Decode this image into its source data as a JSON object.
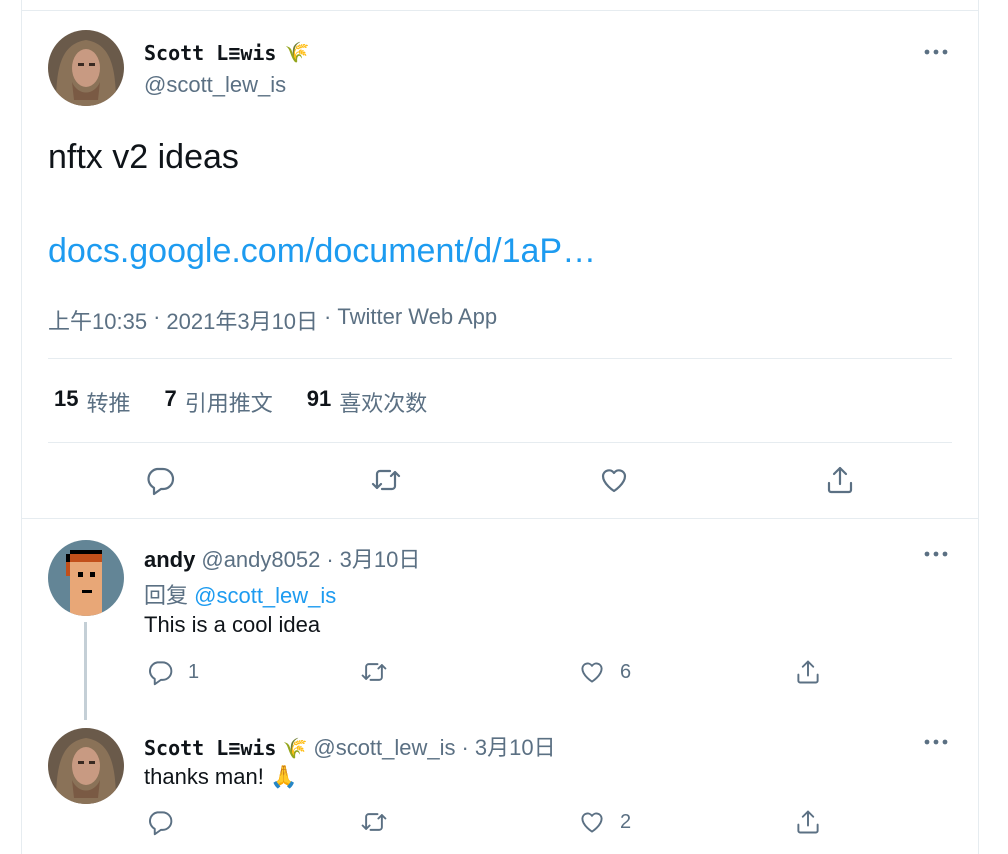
{
  "main_tweet": {
    "author_name": "Scott L≡wis",
    "author_emoji": "🌾",
    "author_handle": "@scott_lew_is",
    "text": "nftx v2 ideas",
    "link_text": "docs.google.com/document/d/1aP…",
    "time": "上午10:35",
    "separator1": "·",
    "date": "2021年3月10日",
    "separator2": "·",
    "app": "Twitter Web App",
    "stats": [
      {
        "num": "15",
        "label": "转推"
      },
      {
        "num": "7",
        "label": "引用推文"
      },
      {
        "num": "91",
        "label": "喜欢次数"
      }
    ]
  },
  "replies": [
    {
      "name": "andy",
      "handle": "@andy8052",
      "dot": "·",
      "date": "3月10日",
      "reply_prefix": "回复",
      "reply_mention": "@scott_lew_is",
      "text": "This is a cool idea",
      "reply_count": "1",
      "retweet_count": "",
      "like_count": "6"
    },
    {
      "name": "Scott L≡wis",
      "emoji": "🌾",
      "handle": "@scott_lew_is",
      "dot": "·",
      "date": "3月10日",
      "text": "thanks man! 🙏",
      "reply_count": "",
      "retweet_count": "",
      "like_count": "2"
    }
  ],
  "icons": {
    "more": "more-horizontal-icon",
    "reply": "reply-bubble-icon",
    "retweet": "retweet-icon",
    "like": "heart-icon",
    "share": "share-icon"
  },
  "colors": {
    "link": "#1d9bf0",
    "secondary_text": "#5b7083",
    "divider": "#e6ecf0"
  }
}
